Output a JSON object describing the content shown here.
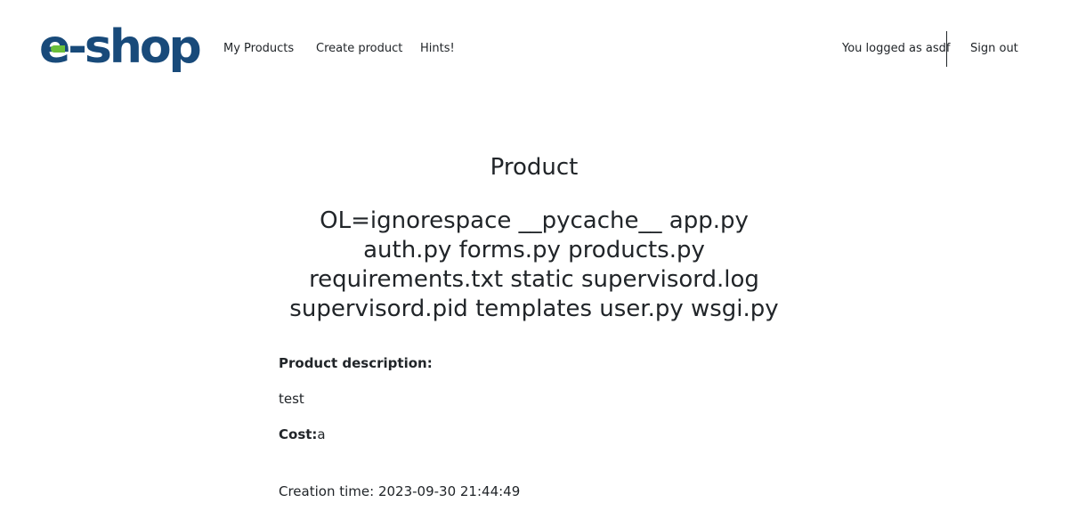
{
  "navbar": {
    "logo_text": "e-shop",
    "links": {
      "my_products": "My Products",
      "create_product": "Create product",
      "hints": "Hints!"
    },
    "user_text": "You logged as asdf",
    "sign_out": "Sign out"
  },
  "main": {
    "title": "Product",
    "product_name": "OL=ignorespace __pycache__ app.py auth.py forms.py products.py requirements.txt static supervisord.log supervisord.pid templates user.py wsgi.py",
    "description_label": "Product description:",
    "description_value": "test",
    "cost_label": "Cost:",
    "cost_value": "a",
    "creation_time": "Creation time: 2023-09-30 21:44:49"
  },
  "colors": {
    "brand_blue": "#184a7a",
    "brand_green": "#6abf3a"
  }
}
